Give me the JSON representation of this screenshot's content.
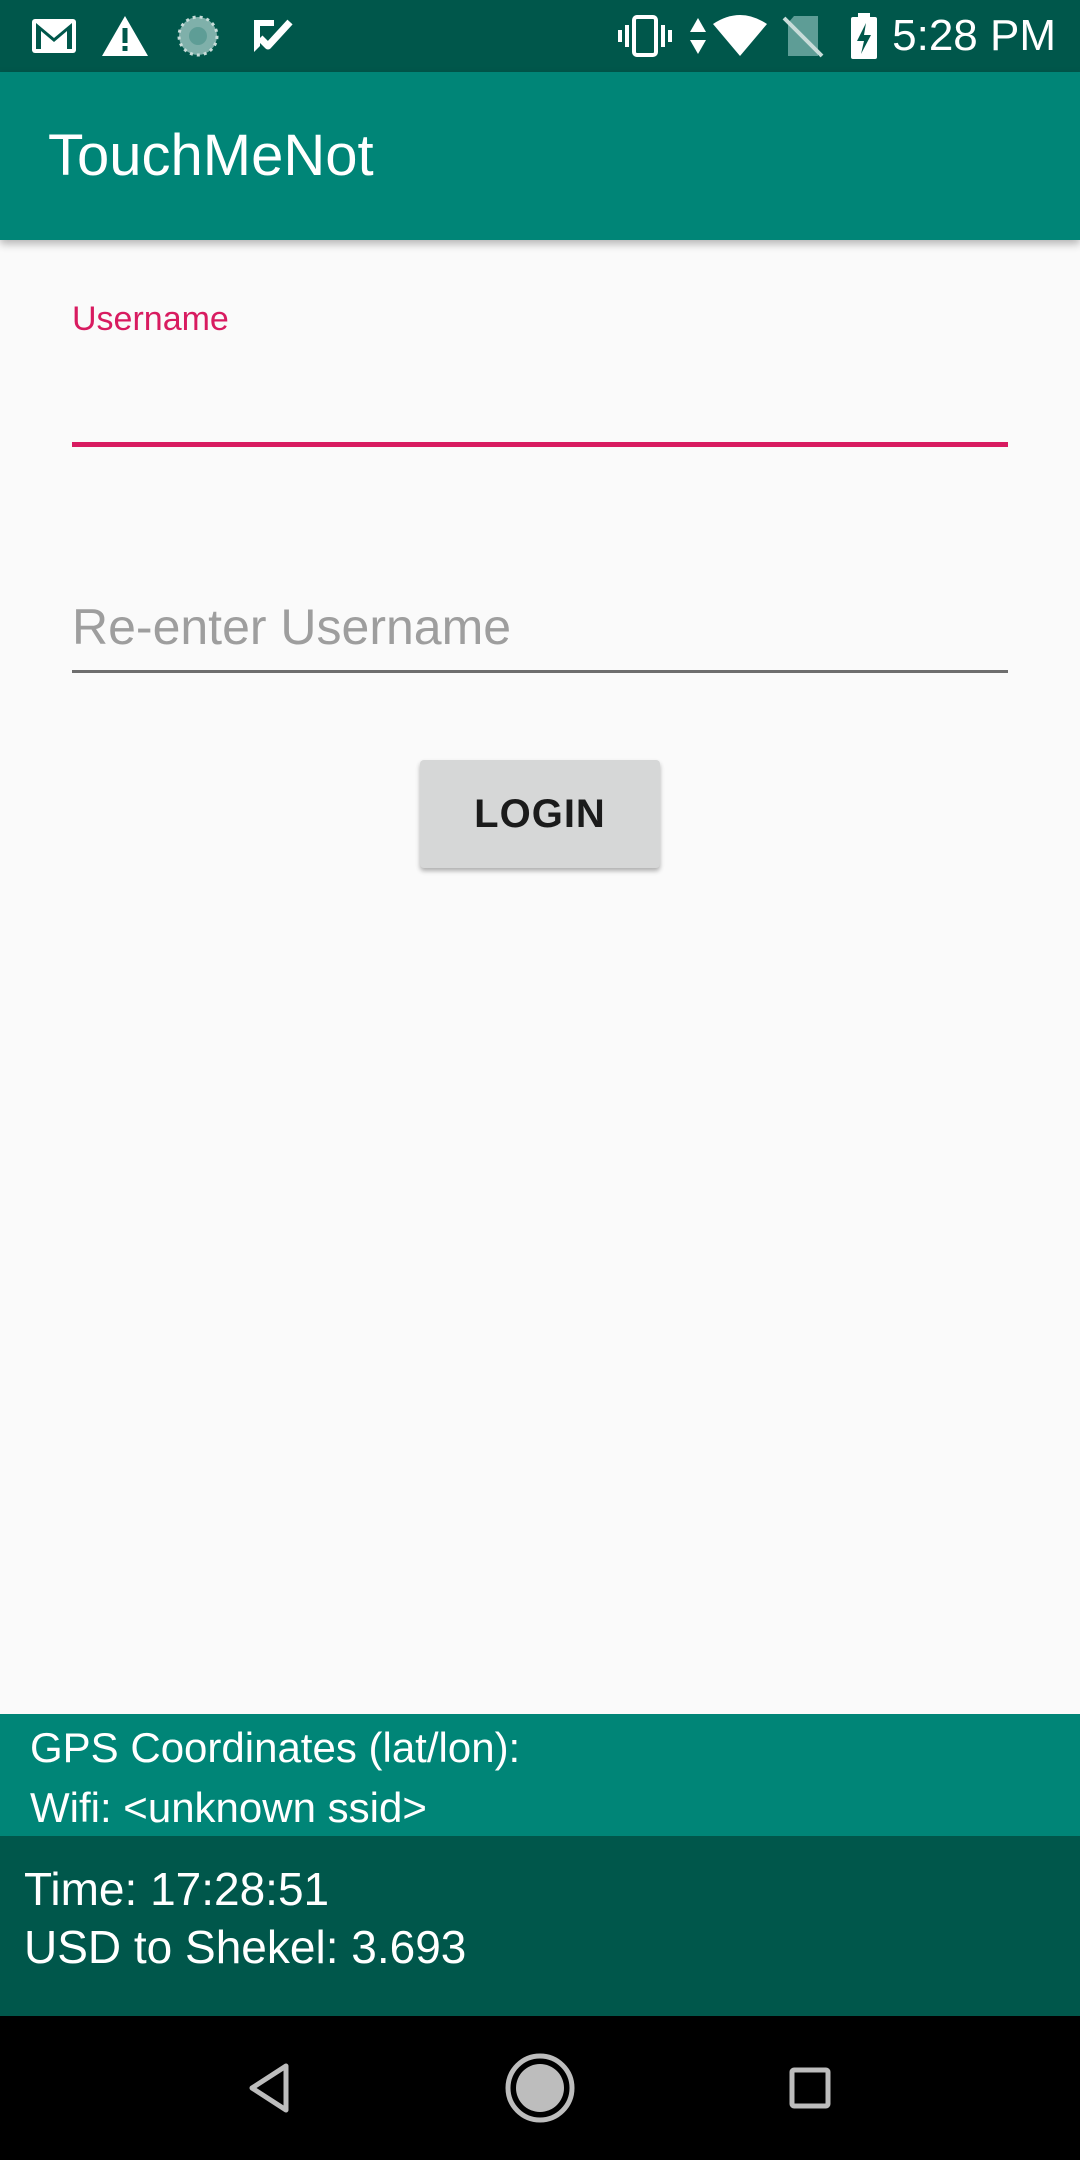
{
  "status_bar": {
    "time": "5:28 PM",
    "left_icons": [
      "gmail-icon",
      "warning-icon",
      "sync-icon",
      "tasks-icon"
    ],
    "right_icons": [
      "vibrate-icon",
      "data-arrows-icon",
      "wifi-icon",
      "no-sim-icon",
      "battery-charging-icon"
    ]
  },
  "app_bar": {
    "title": "TouchMeNot"
  },
  "form": {
    "username": {
      "label": "Username",
      "value": ""
    },
    "reenter_username": {
      "placeholder": "Re-enter Username",
      "value": ""
    },
    "login_label": "LOGIN"
  },
  "info": {
    "gps_label": "GPS Coordinates (lat/lon):",
    "wifi_label": "Wifi: <unknown ssid>",
    "time_label": "Time: 17:28:51",
    "currency_label": "USD to Shekel: 3.693"
  },
  "nav_bar": {
    "icons": [
      "back-icon",
      "home-icon",
      "recents-icon"
    ]
  },
  "colors": {
    "primary": "#008577",
    "primary_dark": "#00574b",
    "accent": "#d81b60",
    "background": "#fafafa",
    "button": "#d6d7d7"
  }
}
